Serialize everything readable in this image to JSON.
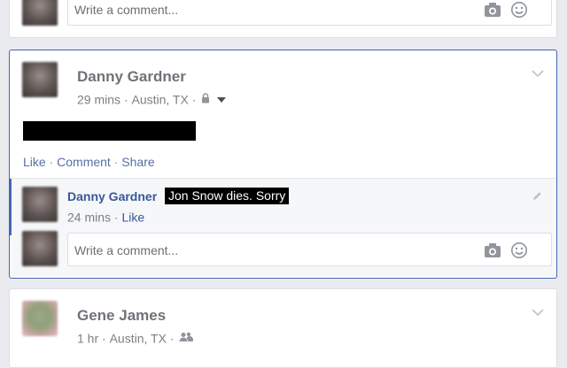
{
  "top_card": {
    "comment_placeholder": "Write a comment..."
  },
  "post1": {
    "author": "Danny Gardner",
    "time": "29 mins",
    "location": "Austin, TX",
    "actions": {
      "like": "Like",
      "comment": "Comment",
      "share": "Share"
    },
    "reply": {
      "author": "Danny Gardner",
      "text": "Jon Snow dies. Sorry",
      "time": "24 mins",
      "like": "Like"
    },
    "comment_placeholder": "Write a comment..."
  },
  "post2": {
    "author": "Gene James",
    "time": "1 hr",
    "location": "Austin, TX"
  },
  "colors": {
    "link": "#365899",
    "action": "#5470a8",
    "focus_border": "#4267b2",
    "spoiler_bg": "#000000"
  },
  "icons": [
    "camera-icon",
    "smiley-icon",
    "chevron-down-icon",
    "lock-icon",
    "caret-down-icon",
    "friends-icon",
    "pencil-icon"
  ]
}
